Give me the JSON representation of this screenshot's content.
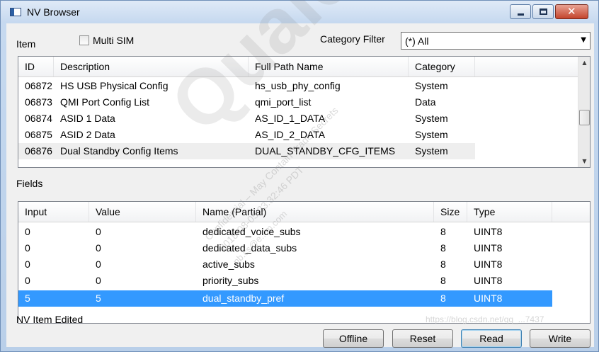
{
  "window": {
    "title": "NV Browser"
  },
  "top_bar": {
    "item_label": "Item",
    "multi_sim_label": "Multi SIM",
    "multi_sim_checked": false,
    "category_filter_label": "Category Filter",
    "category_filter_value": "(*) All"
  },
  "items_table": {
    "columns": [
      "ID",
      "Description",
      "Full Path Name",
      "Category"
    ],
    "rows": [
      {
        "id": "06872",
        "description": "HS USB Physical Config",
        "path": "hs_usb_phy_config",
        "category": "System"
      },
      {
        "id": "06873",
        "description": "QMI Port Config List",
        "path": "qmi_port_list",
        "category": "Data"
      },
      {
        "id": "06874",
        "description": "ASID 1 Data",
        "path": "AS_ID_1_DATA",
        "category": "System"
      },
      {
        "id": "06875",
        "description": "ASID 2 Data",
        "path": "AS_ID_2_DATA",
        "category": "System"
      },
      {
        "id": "06876",
        "description": "Dual Standby Config Items",
        "path": "DUAL_STANDBY_CFG_ITEMS",
        "category": "System"
      }
    ]
  },
  "fields_label": "Fields",
  "fields_table": {
    "columns": [
      "Input",
      "Value",
      "Name (Partial)",
      "Size",
      "Type"
    ],
    "rows": [
      {
        "input": "0",
        "value": "0",
        "name": "dedicated_voice_subs",
        "size": "8",
        "type": "UINT8"
      },
      {
        "input": "0",
        "value": "0",
        "name": "dedicated_data_subs",
        "size": "8",
        "type": "UINT8"
      },
      {
        "input": "0",
        "value": "0",
        "name": "active_subs",
        "size": "8",
        "type": "UINT8"
      },
      {
        "input": "0",
        "value": "0",
        "name": "priority_subs",
        "size": "8",
        "type": "UINT8"
      },
      {
        "input": "5",
        "value": "5",
        "name": "dual_standby_pref",
        "size": "8",
        "type": "UINT8"
      }
    ]
  },
  "status_text": "NV Item Edited",
  "buttons": {
    "offline": "Offline",
    "reset": "Reset",
    "read": "Read",
    "write": "Write"
  },
  "watermarks": {
    "large": "Qualcomm",
    "line1": "Confidential – May Contain Trade Secrets",
    "line2": "2018-08-05 23:32:46 PDT",
    "line3": "pb.cs@e...m.com",
    "footer": "https://blog.csdn.net/qq_...7437"
  },
  "icons": {
    "app": "window-app-icon",
    "minimize": "minimize-icon",
    "maximize": "maximize-icon",
    "close": "close-icon",
    "dropdown": "chevron-down-icon",
    "scroll_up": "scroll-up-icon",
    "scroll_down": "scroll-down-icon"
  },
  "colors": {
    "selection": "#3399ff",
    "close_button": "#c4452d",
    "title_bar": "#c5d8ef"
  }
}
